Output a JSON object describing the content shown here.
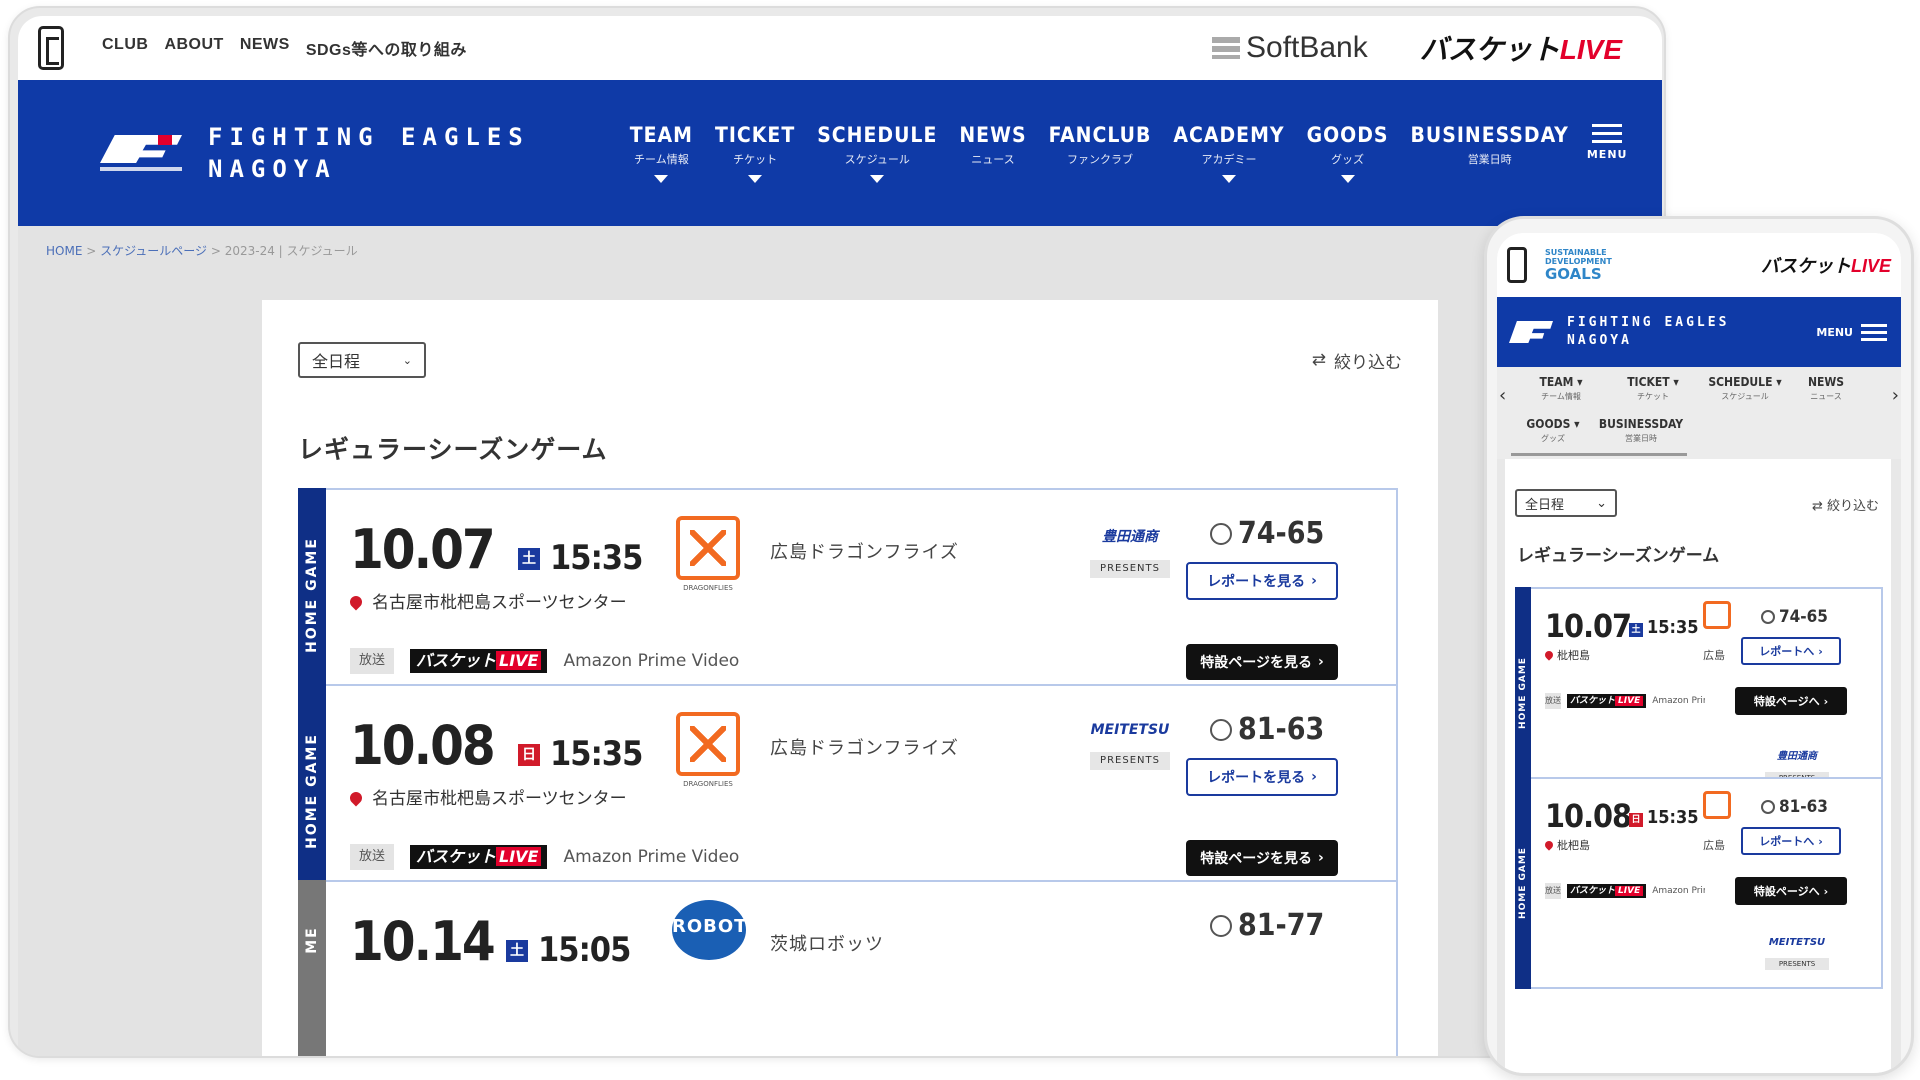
{
  "desktop": {
    "top_links": [
      "CLUB",
      "ABOUT",
      "NEWS",
      "SDGs等への取り組み"
    ],
    "softbank": "SoftBank",
    "basket_live": {
      "left": "バスケット",
      "right": "LIVE"
    },
    "club_name": {
      "line1": "FIGHTING EAGLES",
      "line2": "NAGOYA"
    },
    "nav": [
      {
        "en": "TEAM",
        "jp": "チーム情報",
        "caret": true
      },
      {
        "en": "TICKET",
        "jp": "チケット",
        "caret": true
      },
      {
        "en": "SCHEDULE",
        "jp": "スケジュール",
        "caret": true
      },
      {
        "en": "NEWS",
        "jp": "ニュース",
        "caret": false
      },
      {
        "en": "FANCLUB",
        "jp": "ファンクラブ",
        "caret": false
      },
      {
        "en": "ACADEMY",
        "jp": "アカデミー",
        "caret": true
      },
      {
        "en": "GOODS",
        "jp": "グッズ",
        "caret": true
      },
      {
        "en": "BUSINESSDAY",
        "jp": "営業日時",
        "caret": false
      }
    ],
    "menu_label": "MENU",
    "breadcrumb": {
      "home": "HOME",
      "schedule": "スケジュールページ",
      "current": "2023-24 | スケジュール"
    },
    "filter": {
      "select_value": "全日程",
      "narrow_label": "絞り込む"
    },
    "section_title": "レギュラーシーズンゲーム",
    "band_label": "HOME GAME",
    "band_label_partial": "ME",
    "games": [
      {
        "date": "10.07",
        "day": "土",
        "sun": false,
        "time": "15:35",
        "venue": "名古屋市枇杷島スポーツセンター",
        "opponent": "広島ドラゴンフライズ",
        "team_caption": "DRAGONFLIES",
        "sponsor": "豊田通商",
        "presents": "PRESENTS",
        "score": "74-65",
        "report": "レポートを見る",
        "broadcast_tag": "放送",
        "broadcast_service": "Amazon Prime Video",
        "special": "特設ページを見る"
      },
      {
        "date": "10.08",
        "day": "日",
        "sun": true,
        "time": "15:35",
        "venue": "名古屋市枇杷島スポーツセンター",
        "opponent": "広島ドラゴンフライズ",
        "team_caption": "DRAGONFLIES",
        "sponsor": "MEITETSU",
        "presents": "PRESENTS",
        "score": "81-63",
        "report": "レポートを見る",
        "broadcast_tag": "放送",
        "broadcast_service": "Amazon Prime Video",
        "special": "特設ページを見る"
      },
      {
        "date": "10.14",
        "day": "土",
        "sun": false,
        "time": "15:05",
        "opponent": "茨城ロボッツ",
        "team_caption": "ROBOTS",
        "score": "81-77"
      }
    ]
  },
  "mobile": {
    "sdgs": {
      "line1": "SUSTAINABLE",
      "line2": "DEVELOPMENT",
      "goals": "GOALS"
    },
    "basket_live": {
      "left": "バスケット",
      "right": "LIVE"
    },
    "club_name": {
      "line1": "FIGHTING EAGLES",
      "line2": "NAGOYA"
    },
    "menu_label": "MENU",
    "nav_row1": [
      {
        "en": "TEAM",
        "jp": "チーム情報"
      },
      {
        "en": "TICKET",
        "jp": "チケット"
      },
      {
        "en": "SCHEDULE",
        "jp": "スケジュール"
      },
      {
        "en": "NEWS",
        "jp": "ニュース"
      }
    ],
    "nav_row2": [
      {
        "en": "GOODS",
        "jp": "グッズ"
      },
      {
        "en": "BUSINESSDAY",
        "jp": "営業日時"
      }
    ],
    "filter": {
      "select_value": "全日程",
      "narrow_label": "絞り込む"
    },
    "section_title": "レギュラーシーズンゲーム",
    "band_label": "HOME GAME",
    "games": [
      {
        "date": "10.07",
        "day": "土",
        "sun": false,
        "time": "15:35",
        "venue": "枇杷島",
        "opponent": "広島",
        "score": "74-65",
        "report": "レポートへ",
        "broadcast_tag": "放送",
        "broadcast_service": "Amazon Prime V",
        "special": "特設ページへ",
        "sponsor": "豊田通商",
        "presents": "PRESENTS"
      },
      {
        "date": "10.08",
        "day": "日",
        "sun": true,
        "time": "15:35",
        "venue": "枇杷島",
        "opponent": "広島",
        "score": "81-63",
        "report": "レポートへ",
        "broadcast_tag": "放送",
        "broadcast_service": "Amazon Prime V",
        "special": "特設ページへ",
        "sponsor": "MEITETSU",
        "presents": "PRESENTS"
      }
    ]
  },
  "colors": {
    "brand_blue": "#0f3aa7",
    "band_navy": "#0f2f86",
    "live_red": "#e3002b",
    "sunday_red": "#d11a2a",
    "dragonflies_orange": "#f26a21"
  }
}
